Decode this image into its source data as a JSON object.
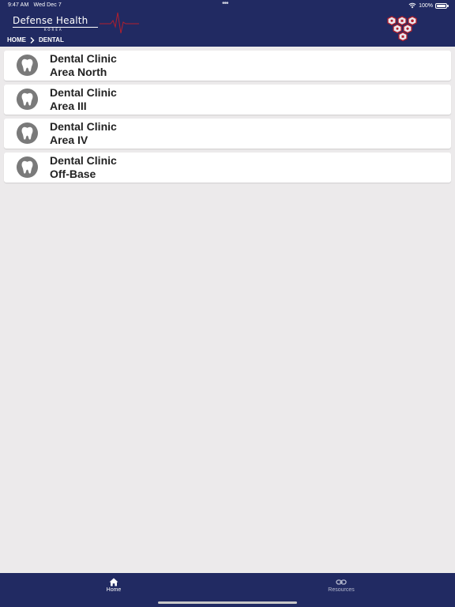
{
  "status_bar": {
    "time": "9:47 AM",
    "date": "Wed Dec 7",
    "battery": "100%",
    "battery_level": 1.0
  },
  "header": {
    "logo_title": "Defense Health",
    "logo_subtitle": "KOREA",
    "colors": {
      "header_bg": "#212a62",
      "pulse": "#b21f2d"
    }
  },
  "breadcrumb": {
    "items": [
      "HOME",
      "DENTAL"
    ]
  },
  "clinics": [
    {
      "title": "Dental Clinic\nArea North",
      "icon": "tooth-icon"
    },
    {
      "title": "Dental Clinic\nArea III",
      "icon": "tooth-icon"
    },
    {
      "title": "Dental Clinic\nArea IV",
      "icon": "tooth-icon"
    },
    {
      "title": "Dental Clinic\nOff-Base",
      "icon": "tooth-icon"
    }
  ],
  "tabbar": {
    "tabs": [
      {
        "label": "Home",
        "icon": "home-icon",
        "active": true
      },
      {
        "label": "Resources",
        "icon": "link-icon",
        "active": false
      }
    ]
  }
}
